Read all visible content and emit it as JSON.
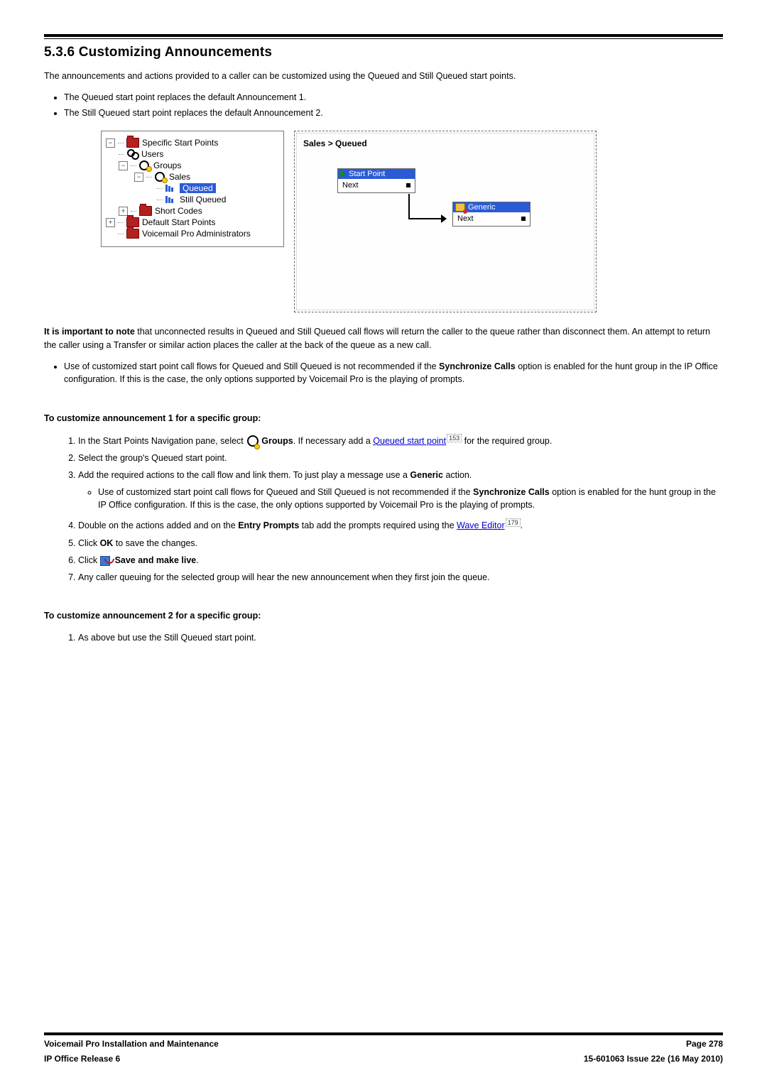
{
  "section": {
    "number": "5.3.6",
    "title": "Customizing Announcements"
  },
  "intro": "The announcements and actions provided to a caller can be customized using the Queued and Still Queued start points.",
  "intro_points": [
    "The Queued start point replaces the default Announcement 1.",
    "The Still Queued start point replaces the default Announcement 2."
  ],
  "tree": {
    "root": "Specific Start Points",
    "users": "Users",
    "groups": "Groups",
    "sales": "Sales",
    "queued": "Queued",
    "still_queued": "Still Queued",
    "short_codes": "Short Codes",
    "default_start": "Default Start Points",
    "vm_admins": "Voicemail Pro Administrators"
  },
  "flow": {
    "breadcrumb": "Sales > Queued",
    "start_point": "Start Point",
    "next": "Next",
    "generic": "Generic"
  },
  "note_paragraph": {
    "prefix": "It is important to note",
    "rest": " that unconnected results in Queued and Still Queued call flows will return the caller to the queue rather than disconnect them. An attempt to return the caller using a Transfer or similar action places the caller at the back of the queue as a new call."
  },
  "sync_note": {
    "pre": "Use of customized start point call flows for Queued and Still Queued is not recommended if the ",
    "bold": "Synchronize Calls",
    "post": " option is enabled for the hunt group in the IP Office configuration. If this is the case, the only options supported by Voicemail Pro is the playing of prompts."
  },
  "procedure1": {
    "heading": "To customize announcement 1 for a specific group:",
    "step1_pre": "In the Start Points Navigation pane, select ",
    "step1_groups": "Groups",
    "step1_mid": ". If necessary add a ",
    "step1_link": "Queued start point",
    "step1_ref": "153",
    "step1_post": " for the required group.",
    "step2": "Select the group's Queued start point.",
    "step3_pre": "Add the required actions to the call flow and link them. To just play a message use a ",
    "step3_bold": "Generic",
    "step3_post": " action.",
    "step4_pre": "Double on the actions added and on the ",
    "step4_bold": "Entry Prompts",
    "step4_mid": " tab add the prompts required using the ",
    "step4_link": "Wave Editor",
    "step4_ref": "179",
    "step4_post": ".",
    "step5_pre": "Click ",
    "step5_bold": "OK",
    "step5_post": " to save the changes.",
    "step6_pre": "Click ",
    "step6_bold": "Save and make live",
    "step6_post": ".",
    "step7": "Any caller queuing for the selected group will hear the new announcement when they first join the queue."
  },
  "procedure2": {
    "heading": "To customize announcement 2 for a specific group:",
    "step1": "As above but use the Still Queued start point."
  },
  "footer": {
    "left1": "Voicemail Pro Installation and Maintenance",
    "left2": "IP Office Release 6",
    "right1": "Page 278",
    "right2": "15-601063 Issue 22e (16 May 2010)"
  }
}
